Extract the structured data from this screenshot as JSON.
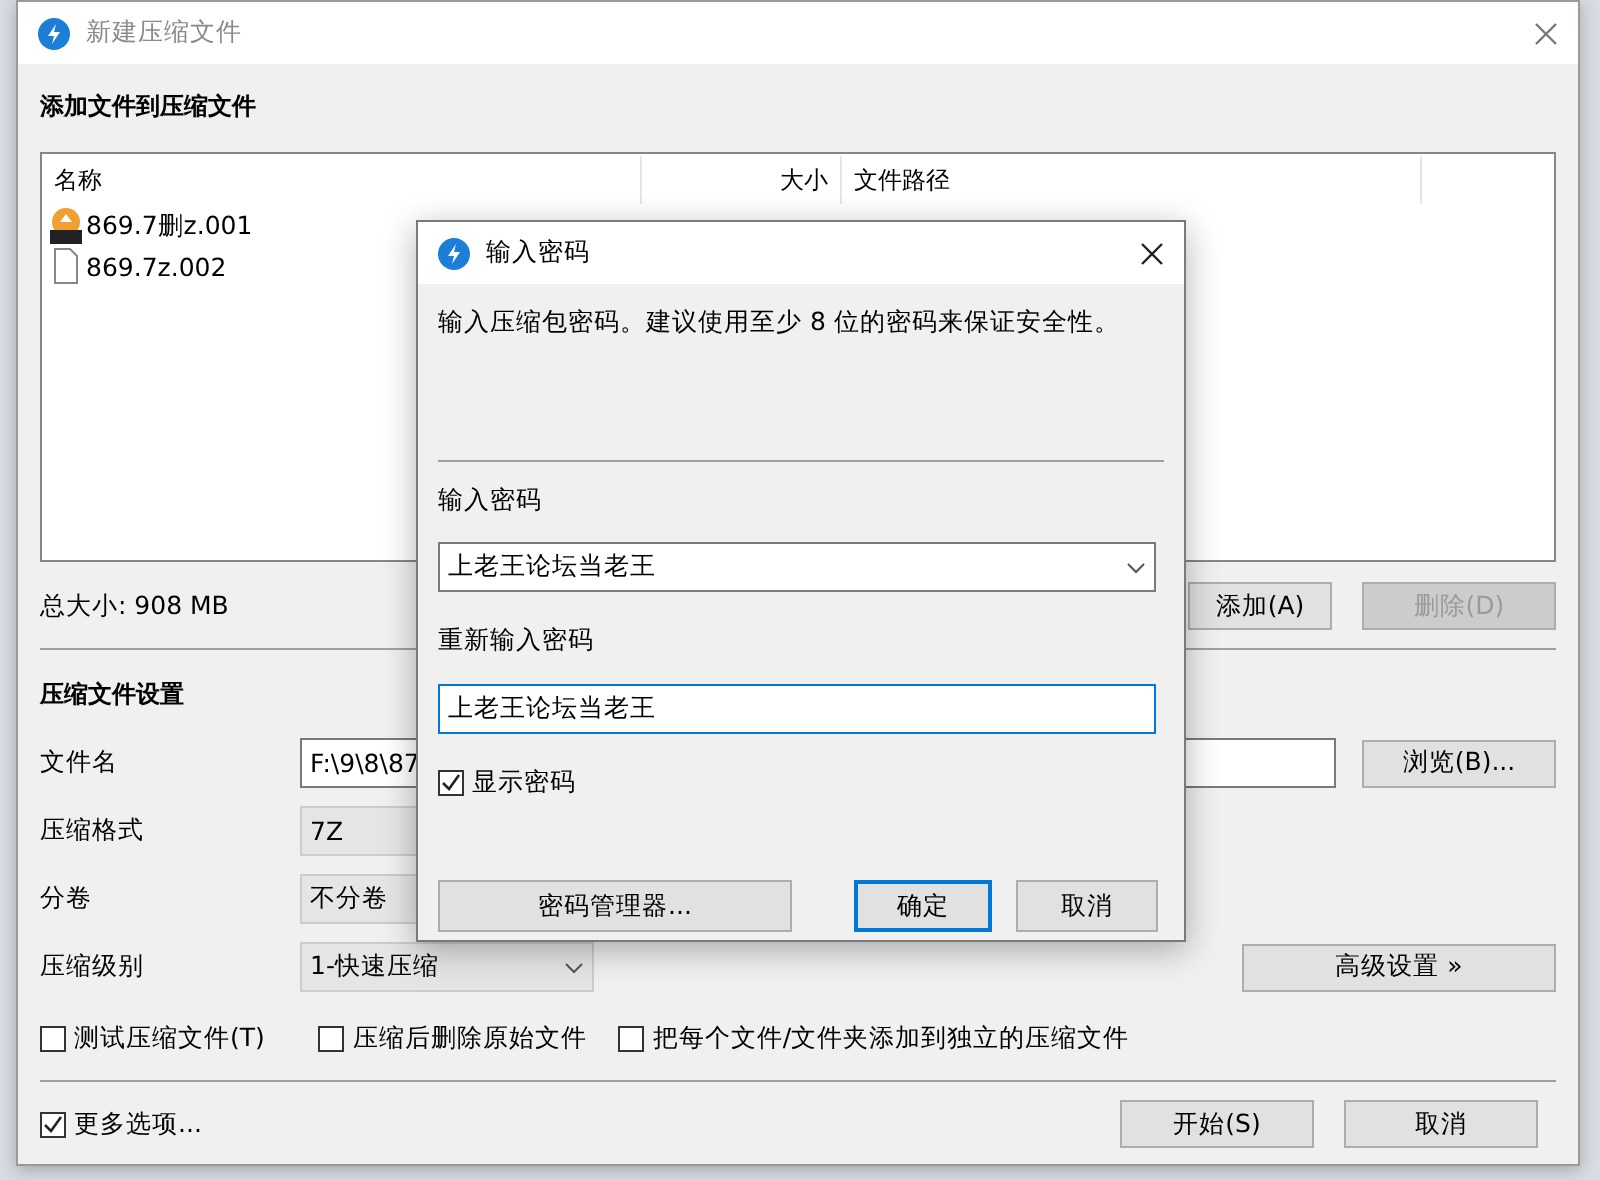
{
  "main_window": {
    "title": "新建压缩文件",
    "files_heading": "添加文件到压缩文件",
    "file_list": {
      "columns": [
        "名称",
        "大小",
        "文件路径"
      ],
      "rows": [
        {
          "kind": "archive",
          "name": "869.7删z.001"
        },
        {
          "kind": "document",
          "name": "869.7z.002"
        }
      ]
    },
    "total_size": "总大小: 908 MB",
    "list_buttons": [
      {
        "label": "添加(A)",
        "disabled": false
      },
      {
        "label": "删除(D)",
        "disabled": true
      }
    ],
    "settings_heading": "压缩文件设置",
    "fields": [
      {
        "kind": "input",
        "label": "文件名",
        "value": "F:\\9\\8\\87",
        "button": "浏览(B)..."
      },
      {
        "kind": "select",
        "label": "压缩格式",
        "value": "7Z"
      },
      {
        "kind": "select",
        "label": "分卷",
        "value": "不分卷"
      },
      {
        "kind": "select",
        "label": "压缩级别",
        "value": "1-快速压缩",
        "dropdown_arrow": true,
        "button": "高级设置 »"
      }
    ],
    "options": [
      {
        "label": "测试压缩文件(T)",
        "checked": false
      },
      {
        "label": "压缩后删除原始文件",
        "checked": false
      },
      {
        "label": "把每个文件/文件夹添加到独立的压缩文件",
        "checked": false
      }
    ],
    "more_options": {
      "label": "更多选项...",
      "checked": true
    },
    "buttons": [
      "开始(S)",
      "取消"
    ]
  },
  "password_dialog": {
    "title": "输入密码",
    "message": "输入压缩包密码。建议使用至少 8 位的密码来保证安全性。",
    "password_label": "输入密码",
    "password_value": "上老王论坛当老王",
    "confirm_label": "重新输入密码",
    "confirm_value": "上老王论坛当老王",
    "show_password": {
      "label": "显示密码",
      "checked": true
    },
    "manager_button": "密码管理器...",
    "buttons": [
      {
        "label": "确定",
        "default": true
      },
      {
        "label": "取消",
        "default": false
      }
    ]
  }
}
